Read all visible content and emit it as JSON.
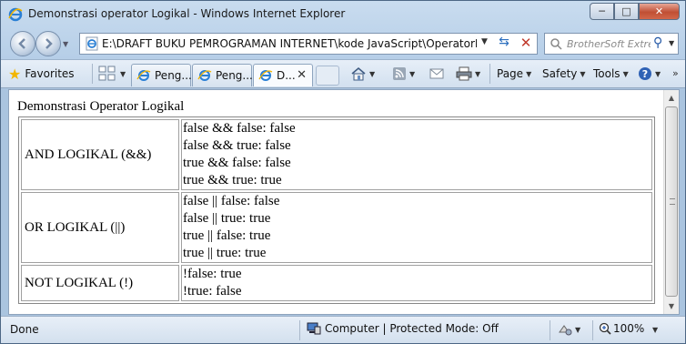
{
  "window": {
    "title": "Demonstrasi operator Logikal - Windows Internet Explorer",
    "minimize": "─",
    "maximize": "□",
    "close": "✕"
  },
  "address_bar": {
    "url": "E:\\DRAFT BUKU PEMROGRAMAN INTERNET\\kode JavaScript\\OperatorLogikal.htm",
    "search_placeholder": "BrotherSoft Extreme"
  },
  "favorites_bar": {
    "favorites_label": "Favorites",
    "tabs": [
      {
        "label": "Peng...",
        "active": false
      },
      {
        "label": "Peng...",
        "active": false
      },
      {
        "label": "D...",
        "active": true
      }
    ],
    "commands": {
      "page": "Page",
      "safety": "Safety",
      "tools": "Tools"
    }
  },
  "content": {
    "heading": "Demonstrasi Operator Logikal",
    "rows": [
      {
        "label": "AND LOGIKAL (&&)",
        "lines": [
          "false && false: false",
          "false && true: false",
          "true && false: false",
          "true && true: true"
        ]
      },
      {
        "label": "OR LOGIKAL (||)",
        "lines": [
          "false || false: false",
          "false || true: true",
          "true || false: true",
          "true || true: true"
        ]
      },
      {
        "label": "NOT LOGIKAL (!)",
        "lines": [
          "!false: true",
          "!true: false"
        ]
      }
    ]
  },
  "status_bar": {
    "status": "Done",
    "zone": "Computer | Protected Mode: Off",
    "zoom": "100%"
  },
  "colors": {
    "chrome": "#b7cfe8",
    "close_button": "#c04f34",
    "accent_link": "#2c6fbf"
  }
}
